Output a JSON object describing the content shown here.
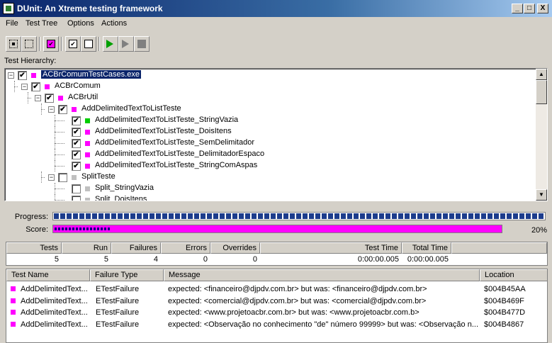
{
  "window": {
    "title": "DUnit: An Xtreme testing framework",
    "min": "_",
    "max": "□",
    "close": "X"
  },
  "menu": [
    {
      "label": "File"
    },
    {
      "label": "Test Tree"
    },
    {
      "label": "Options"
    },
    {
      "label": "Actions"
    }
  ],
  "toolbar": {
    "icons": [
      "select-all-icon",
      "deselect-all-icon",
      "select-failed-icon",
      "check-icon",
      "uncheck-icon",
      "run-icon",
      "run-selected-icon",
      "stop-icon"
    ]
  },
  "tree": {
    "label": "Test Hierarchy:",
    "colors": {
      "failed": "#ff00ff",
      "passed": "#00cc00",
      "notrun": "#c0c0c0"
    },
    "nodes": [
      {
        "label": "ACBrComumTestCases.exe",
        "level": 0,
        "expand": "−",
        "checked": true,
        "status": "failed",
        "selected": true
      },
      {
        "label": "ACBrComum",
        "level": 1,
        "expand": "−",
        "checked": true,
        "status": "failed"
      },
      {
        "label": "ACBrUtil",
        "level": 2,
        "expand": "−",
        "checked": true,
        "status": "failed"
      },
      {
        "label": "AddDelimitedTextToListTeste",
        "level": 3,
        "expand": "−",
        "checked": true,
        "status": "failed"
      },
      {
        "label": "AddDelimitedTextToListTeste_StringVazia",
        "level": 4,
        "checked": true,
        "status": "passed"
      },
      {
        "label": "AddDelimitedTextToListTeste_DoisItens",
        "level": 4,
        "checked": true,
        "status": "failed"
      },
      {
        "label": "AddDelimitedTextToListTeste_SemDelimitador",
        "level": 4,
        "checked": true,
        "status": "failed"
      },
      {
        "label": "AddDelimitedTextToListTeste_DelimitadorEspaco",
        "level": 4,
        "checked": true,
        "status": "failed"
      },
      {
        "label": "AddDelimitedTextToListTeste_StringComAspas",
        "level": 4,
        "checked": true,
        "status": "failed"
      },
      {
        "label": "SplitTeste",
        "level": 3,
        "expand": "−",
        "checked": false,
        "status": "notrun"
      },
      {
        "label": "Split_StringVazia",
        "level": 4,
        "checked": false,
        "status": "notrun"
      },
      {
        "label": "Split_DoisItens",
        "level": 4,
        "checked": false,
        "status": "notrun"
      }
    ]
  },
  "progress": {
    "progress_label": "Progress:",
    "score_label": "Score:",
    "progress_fraction": 1.0,
    "score_fraction": 0.2,
    "score_text": "20%",
    "progress_color": "#1c3c8c",
    "score_color": "#ff00ff"
  },
  "stats": {
    "headers": [
      "Tests",
      "Run",
      "Failures",
      "Errors",
      "Overrides",
      "Test Time",
      "Total Time"
    ],
    "values": [
      "5",
      "5",
      "4",
      "0",
      "0",
      "0:00:00.005",
      "0:00:00.005"
    ]
  },
  "failures": {
    "headers": [
      "Test Name",
      "Failure Type",
      "Message",
      "Location"
    ],
    "rows": [
      {
        "name": "AddDelimitedText...",
        "type": "ETestFailure",
        "message": "expected: <financeiro@djpdv.com.br> but was: <financeiro@djpdv.com.br>",
        "location": "$004B45AA"
      },
      {
        "name": "AddDelimitedText...",
        "type": "ETestFailure",
        "message": "expected: <comercial@djpdv.com.br> but was: <comercial@djpdv.com.br>",
        "location": "$004B469F"
      },
      {
        "name": "AddDelimitedText...",
        "type": "ETestFailure",
        "message": "expected: <www.projetoacbr.com.br> but was: <www.projetoacbr.com.b>",
        "location": "$004B477D"
      },
      {
        "name": "AddDelimitedText...",
        "type": "ETestFailure",
        "message": "expected: <Observação no conhecimento \"de\" número 99999> but was: <Observação n...",
        "location": "$004B4867"
      }
    ]
  }
}
